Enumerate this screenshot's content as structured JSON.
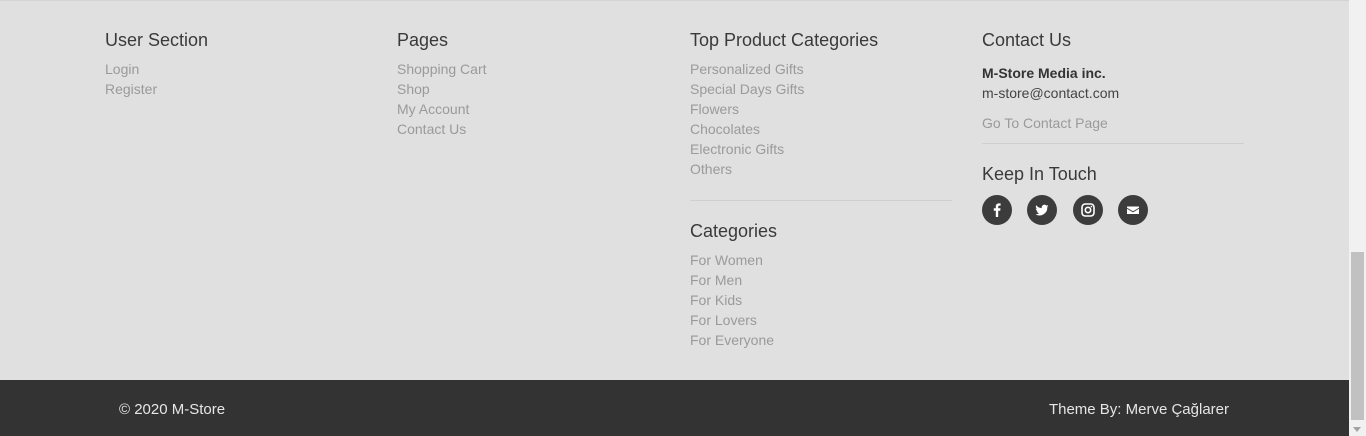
{
  "user_section": {
    "title": "User Section",
    "links": [
      "Login",
      "Register"
    ]
  },
  "pages": {
    "title": "Pages",
    "links": [
      "Shopping Cart",
      "Shop",
      "My Account",
      "Contact Us"
    ]
  },
  "top_categories": {
    "title": "Top Product Categories",
    "links": [
      "Personalized Gifts",
      "Special Days Gifts",
      "Flowers",
      "Chocolates",
      "Electronic Gifts",
      "Others"
    ]
  },
  "categories": {
    "title": "Categories",
    "links": [
      "For Women",
      "For Men",
      "For Kids",
      "For Lovers",
      "For Everyone"
    ]
  },
  "contact": {
    "title": "Contact Us",
    "company": "M-Store Media inc.",
    "email": "m-store@contact.com",
    "page_link": "Go To Contact Page"
  },
  "keep_in_touch": {
    "title": "Keep In Touch",
    "icons": [
      "facebook-icon",
      "twitter-icon",
      "instagram-icon",
      "envelope-icon"
    ]
  },
  "bottom": {
    "copyright": "© 2020 M-Store",
    "theme_by": "Theme By: Merve Çağlarer"
  },
  "colors": {
    "footer_bg": "#e0e0e0",
    "bottom_bar_bg": "#333333",
    "social_bg": "#3c3c3c",
    "link": "#9a9a9a"
  }
}
